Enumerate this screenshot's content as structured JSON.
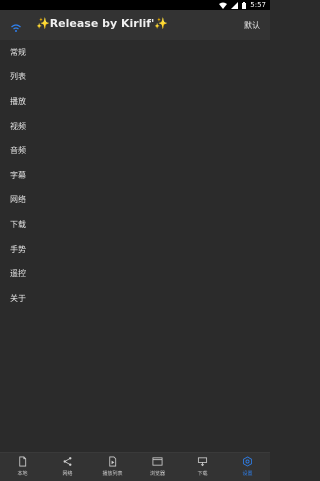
{
  "status_bar": {
    "time": "5:57",
    "icons": [
      "wifi-icon",
      "signal-icon",
      "battery-icon"
    ]
  },
  "header": {
    "title_prefix": "✨",
    "title": "Release by Kirlif'",
    "title_suffix": "✨",
    "action_label": "默认",
    "logo_icon": "wifi-cast-icon"
  },
  "menu": {
    "items": [
      {
        "label": "常规"
      },
      {
        "label": "列表"
      },
      {
        "label": "播放"
      },
      {
        "label": "视频"
      },
      {
        "label": "音频"
      },
      {
        "label": "字幕"
      },
      {
        "label": "网络"
      },
      {
        "label": "下载"
      },
      {
        "label": "手势"
      },
      {
        "label": "遥控"
      },
      {
        "label": "关于"
      }
    ]
  },
  "bottom_nav": {
    "tabs": [
      {
        "label": "本地",
        "icon": "file-icon"
      },
      {
        "label": "网络",
        "icon": "share-icon"
      },
      {
        "label": "播放列表",
        "icon": "playlist-icon"
      },
      {
        "label": "浏览器",
        "icon": "browser-icon"
      },
      {
        "label": "下载",
        "icon": "download-icon"
      },
      {
        "label": "设置",
        "icon": "settings-icon",
        "active": true
      }
    ]
  },
  "colors": {
    "accent": "#2f80ed",
    "background": "#2b2b2b",
    "bar": "#333333",
    "sparkle": "#f2c94c"
  }
}
